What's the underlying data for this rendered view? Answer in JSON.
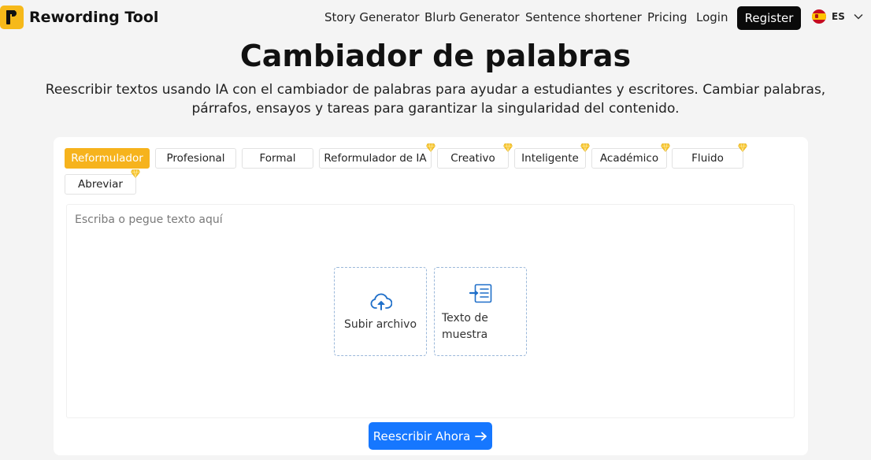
{
  "header": {
    "logo_text": "Rewording Tool",
    "nav": [
      "Story Generator",
      "Blurb Generator",
      "Sentence shortener",
      "Pricing",
      "Login"
    ],
    "register_label": "Register",
    "lang_code": "ES"
  },
  "hero": {
    "title": "Cambiador de palabras",
    "subtitle": "Reescribir textos usando IA con el cambiador de palabras para ayudar a estudiantes y escritores. Cambiar palabras, párrafos, ensayos y tareas para garantizar la singularidad del contenido."
  },
  "modes": [
    {
      "label": "Reformulador",
      "active": true,
      "premium": false
    },
    {
      "label": "Profesional",
      "active": false,
      "premium": false
    },
    {
      "label": "Formal",
      "active": false,
      "premium": false
    },
    {
      "label": "Reformulador de IA",
      "active": false,
      "premium": true
    },
    {
      "label": "Creativo",
      "active": false,
      "premium": true
    },
    {
      "label": "Inteligente",
      "active": false,
      "premium": true
    },
    {
      "label": "Académico",
      "active": false,
      "premium": true
    },
    {
      "label": "Fluido",
      "active": false,
      "premium": true
    },
    {
      "label": "Abreviar",
      "active": false,
      "premium": true
    }
  ],
  "editor": {
    "placeholder": "Escriba o pegue texto aquí",
    "upload_label": "Subir archivo",
    "sample_label_line1": "Texto de",
    "sample_label_line2": "muestra"
  },
  "submit_label": "Reescribir Ahora",
  "colors": {
    "accent": "#f6b31d",
    "primary": "#1677ff",
    "premium_gem": "#f7c531"
  },
  "icons": {
    "upload": "cloud-upload-icon",
    "sample": "sample-text-icon",
    "gem": "premium-gem-icon",
    "arrow": "arrow-right-icon"
  }
}
